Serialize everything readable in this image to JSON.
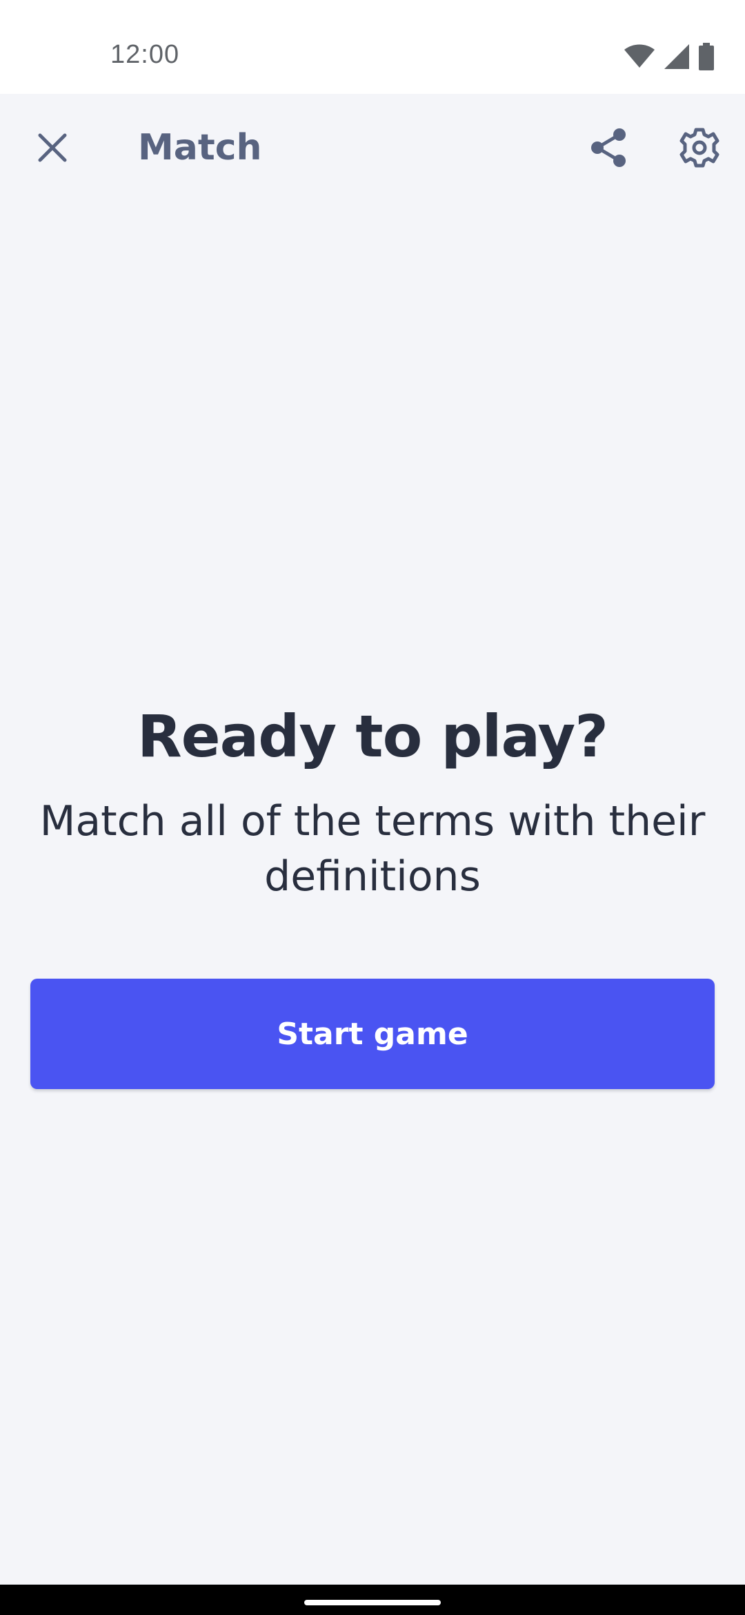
{
  "status_bar": {
    "time": "12:00",
    "icons": [
      "wifi-icon",
      "cellular-signal-icon",
      "battery-icon"
    ]
  },
  "app_bar": {
    "title": "Match",
    "close_icon": "close-icon",
    "share_icon": "share-icon",
    "settings_icon": "gear-icon"
  },
  "main": {
    "headline": "Ready to play?",
    "subtitle": "Match all of the terms with their definitions",
    "start_button_label": "Start game"
  },
  "colors": {
    "background": "#f4f5f9",
    "primary_button": "#4a54f2",
    "heading_text": "#282e3e",
    "toolbar_icon": "#586380"
  }
}
